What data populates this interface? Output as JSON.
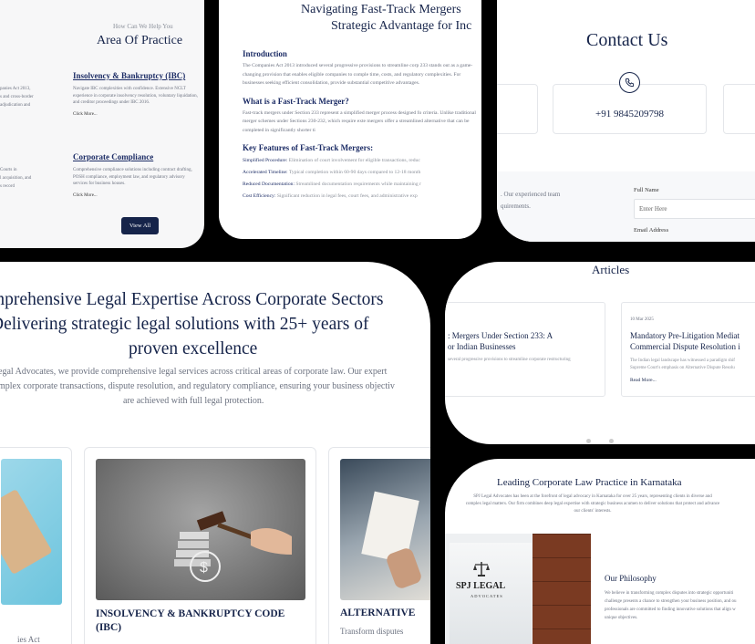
{
  "practice": {
    "eyebrow": "How Can We Help You",
    "title": "Area Of Practice",
    "left_snippets": [
      "panies Act 2013,",
      "s and cross-border",
      "adjudication and",
      "Courts in",
      "l acquisition, and",
      "s record"
    ],
    "items": [
      {
        "title": "Insolvency & Bankruptcy (IBC)",
        "desc": "Navigate IBC complexities with confidence. Extensive NCLT experience in corporate insolvency resolution, voluntary liquidation, and creditor proceedings under IBC 2016.",
        "link": "Click More..."
      },
      {
        "title": "Corporate Compliance",
        "desc": "Comprehensive compliance solutions including contract drafting, POSH compliance, employment law, and regulatory advisory services for business houses.",
        "link": "Click More..."
      }
    ],
    "view_all": "View All"
  },
  "article": {
    "title_line1": "Navigating Fast-Track Mergers",
    "title_line2": "Strategic Advantage for Inc",
    "sections": [
      {
        "heading": "Introduction",
        "body": "The Companies Act 2013 introduced several progressive provisions to streamline corp 233 stands out as a game-changing provision that enables eligible companies to comple time, costs, and regulatory complexities. For businesses seeking efficient consolidation, provide substantial competitive advantages."
      },
      {
        "heading": "What is a Fast-Track Merger?",
        "body": "Fast-track mergers under Section 233 represent a simplified merger process designed fo criteria. Unlike traditional merger schemes under Sections 230-232, which require exte mergers offer a streamlined alternative that can be completed in significantly shorter ti"
      }
    ],
    "features_heading": "Key Features of Fast-Track Mergers:",
    "features": [
      {
        "label": "Simplified Procedure:",
        "text": "Elimination of court involvement for eligible transactions, reduc"
      },
      {
        "label": "Accelerated Timeline:",
        "text": "Typical completion within 60-90 days compared to 12-18 month"
      },
      {
        "label": "Reduced Documentation:",
        "text": "Streamlined documentation requirements while maintaining r"
      },
      {
        "label": "Cost Efficiency:",
        "text": "Significant reduction in legal fees, court fees, and administrative exp"
      }
    ]
  },
  "contact": {
    "title": "Contact Us",
    "phone": "+91 9845209798",
    "left_text_1": ". Our experienced team",
    "left_text_2": "quirements.",
    "full_name_label": "Full Name",
    "full_name_placeholder": "Enter Here",
    "email_label": "Email Address"
  },
  "hero": {
    "line1": "mprehensive Legal Expertise Across Corporate Sectors",
    "line2": "Delivering strategic legal solutions with 25+ years of",
    "line3": "proven excellence",
    "para1": "egal Advocates, we provide comprehensive legal services across critical areas of corporate law. Our expert",
    "para2": "mplex corporate transactions, dispute resolution, and regulatory compliance, ensuring your business objectiv",
    "para3": "are achieved with full legal protection.",
    "left_caption": "ies Act",
    "cards": [
      {
        "title": "INSOLVENCY & BANKRUPTCY CODE (IBC)"
      },
      {
        "title": "ALTERNATIVE",
        "desc": "Transform disputes"
      }
    ]
  },
  "articles": {
    "title": "Articles",
    "cards": [
      {
        "title_line1": ": Mergers Under Section 233: A",
        "title_line2": "or Indian Businesses",
        "excerpt": "several progressive provisions to streamline corporate restructuring"
      },
      {
        "date": "10 Mar 2025",
        "title_line1": "Mandatory Pre-Litigation Mediat",
        "title_line2": "Commercial Dispute Resolution i",
        "excerpt_line1": "The Indian legal landscape has witnessed a paradigm shif",
        "excerpt_line2": "Supreme Court's emphasis on Alternative Dispute Resolu",
        "link": "Read More..."
      }
    ]
  },
  "about": {
    "title": "Leading Corporate Law Practice in Karnataka",
    "para": "SPJ Legal Advocates has been at the forefront of legal advocacy in Karnataka for over 25 years, representing clients in diverse and complex legal matters. Our firm combines deep legal expertise with strategic business acumen to deliver solutions that protect and advance our clients' interests.",
    "sign_name": "SPJ LEGAL",
    "sign_sub": "ADVOCATES",
    "philosophy_title": "Our Philosophy",
    "philosophy_line1": "We believe in transforming complex disputes into strategic opportuniti",
    "philosophy_line2": "challenge presents a chance to strengthen your business position, and ou",
    "philosophy_line3": "professionals are committed to finding innovative solutions that align w",
    "philosophy_line4": "unique objectives."
  }
}
